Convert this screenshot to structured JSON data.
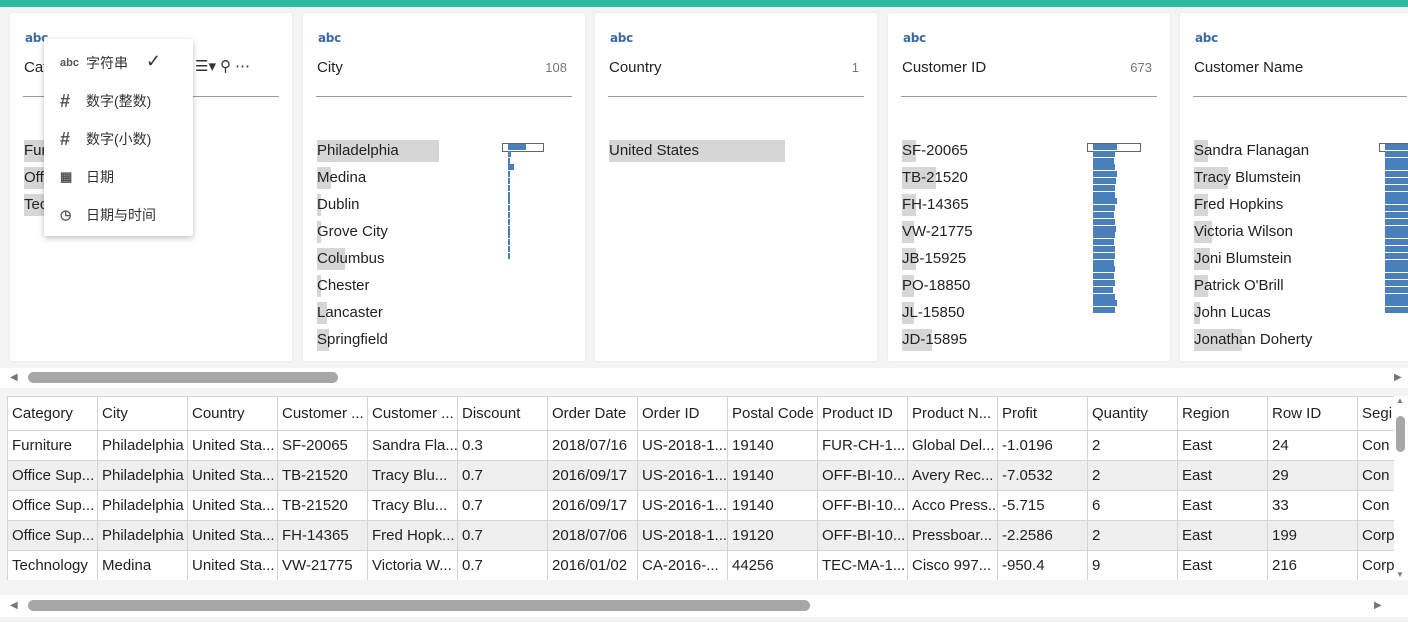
{
  "profile_cards": [
    {
      "type": "abc",
      "name": "Category",
      "name_visible": "Cat",
      "count": "",
      "values": [
        "Furniture",
        "Office Supplies",
        "Technology"
      ],
      "values_visible": [
        "Fur",
        "Off",
        "Tec"
      ],
      "hist": []
    },
    {
      "type": "abc",
      "name": "City",
      "count": "108",
      "values": [
        "Philadelphia",
        "Medina",
        "Dublin",
        "Grove City",
        "Columbus",
        "Chester",
        "Lancaster",
        "Springfield"
      ],
      "hist": [
        1.0,
        0.17,
        0.05,
        0.33,
        0.05,
        0.04,
        0.04,
        0.03,
        0.03,
        0.03,
        0.03,
        0.02,
        0.02,
        0.02,
        0.02,
        0.02,
        0.02
      ]
    },
    {
      "type": "abc",
      "name": "Country",
      "count": "1",
      "values": [
        "United States"
      ],
      "hist": []
    },
    {
      "type": "abc",
      "name": "Customer ID",
      "count": "673",
      "values": [
        "SF-20065",
        "TB-21520",
        "FH-14365",
        "VW-21775",
        "JB-15925",
        "PO-18850",
        "JL-15850",
        "JD-15895"
      ],
      "hist": [
        1.0,
        0.9,
        0.88,
        0.92,
        1.0,
        0.95,
        0.9,
        0.93,
        0.98,
        0.9,
        0.88,
        0.92,
        0.95,
        0.9,
        0.88,
        0.93,
        0.9,
        0.87,
        0.9,
        0.88,
        0.92,
        0.84,
        0.9,
        1.0,
        0.9
      ]
    },
    {
      "type": "abc",
      "name": "Customer Name",
      "count": "",
      "values": [
        "Sandra Flanagan",
        "Tracy Blumstein",
        "Fred Hopkins",
        "Victoria Wilson",
        "Joni Blumstein",
        "Patrick O'Brill",
        "John Lucas",
        "Jonathan Doherty"
      ],
      "hist": [
        1.0,
        0.95,
        0.95,
        0.95,
        0.95,
        0.95,
        0.95,
        0.95,
        0.95,
        0.95,
        0.95,
        0.95,
        0.95,
        0.95,
        0.95,
        0.95,
        0.95,
        0.95,
        0.95,
        0.95,
        0.95,
        0.95,
        0.95,
        0.95,
        0.95
      ]
    }
  ],
  "type_menu": {
    "items": [
      {
        "icon": "abc",
        "label": "字符串",
        "checked": true
      },
      {
        "icon": "#",
        "label": "数字(整数)"
      },
      {
        "icon": "#",
        "label": "数字(小数)"
      },
      {
        "icon": "calendar",
        "label": "日期"
      },
      {
        "icon": "calendar-clock",
        "label": "日期与时间"
      }
    ]
  },
  "grid": {
    "columns": [
      "Category",
      "City",
      "Country",
      "Customer ...",
      "Customer ...",
      "Discount",
      "Order Date",
      "Order ID",
      "Postal Code",
      "Product ID",
      "Product N...",
      "Profit",
      "Quantity",
      "Region",
      "Row ID",
      "Segi"
    ],
    "rows": [
      [
        "Furniture",
        "Philadelphia",
        "United Sta...",
        "SF-20065",
        "Sandra Fla...",
        "0.3",
        "2018/07/16",
        "US-2018-1...",
        "19140",
        "FUR-CH-1...",
        "Global Del...",
        "-1.0196",
        "2",
        "East",
        "24",
        "Con"
      ],
      [
        "Office Sup...",
        "Philadelphia",
        "United Sta...",
        "TB-21520",
        "Tracy Blu...",
        "0.7",
        "2016/09/17",
        "US-2016-1...",
        "19140",
        "OFF-BI-10...",
        "Avery Rec...",
        "-7.0532",
        "2",
        "East",
        "29",
        "Con"
      ],
      [
        "Office Sup...",
        "Philadelphia",
        "United Sta...",
        "TB-21520",
        "Tracy Blu...",
        "0.7",
        "2016/09/17",
        "US-2016-1...",
        "19140",
        "OFF-BI-10...",
        "Acco Press...",
        "-5.715",
        "6",
        "East",
        "33",
        "Con"
      ],
      [
        "Office Sup...",
        "Philadelphia",
        "United Sta...",
        "FH-14365",
        "Fred Hopk...",
        "0.7",
        "2018/07/06",
        "US-2018-1...",
        "19120",
        "OFF-BI-10...",
        "Pressboar...",
        "-2.2586",
        "2",
        "East",
        "199",
        "Corp"
      ],
      [
        "Technology",
        "Medina",
        "United Sta...",
        "VW-21775",
        "Victoria W...",
        "0.7",
        "2016/01/02",
        "CA-2016-...",
        "44256",
        "TEC-MA-1...",
        "Cisco 997...",
        "-950.4",
        "9",
        "East",
        "216",
        "Corp"
      ]
    ]
  },
  "colors": {
    "accent": "#2dbd9e",
    "bar": "#4a7fba",
    "highlight": "#d6d6d6"
  }
}
